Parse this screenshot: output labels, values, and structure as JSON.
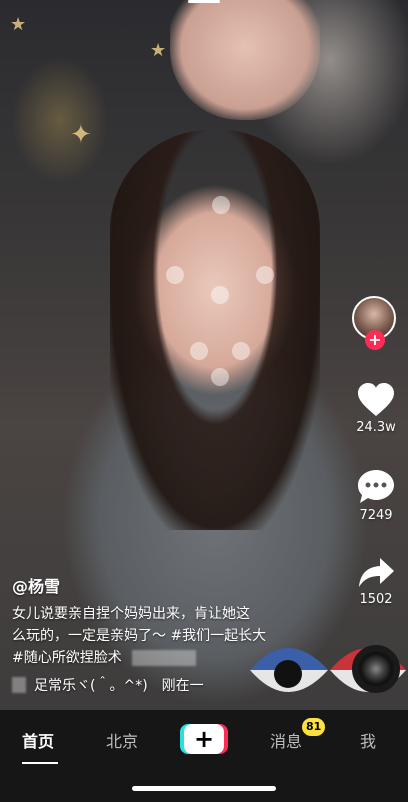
{
  "user": {
    "username": "@杨雪",
    "caption_line1": "女儿说要亲自捏个妈妈出来，肯让她这",
    "caption_line2": "么玩的，一定是亲妈了～ #我们一起长大",
    "caption_line3": "#随心所欲捏脸术",
    "music_text": "足常乐ヾ(＾。^*)　刚在一"
  },
  "actions": {
    "likes": "24.3w",
    "comments": "7249",
    "shares": "1502"
  },
  "nav": {
    "home": "首页",
    "city": "北京",
    "create": "+",
    "messages": "消息",
    "messages_badge": "81",
    "me": "我"
  },
  "colors": {
    "accent_red": "#fe2c55",
    "accent_cyan": "#2ae0df",
    "badge_yellow": "#fee041",
    "nav_bg": "#161616"
  }
}
